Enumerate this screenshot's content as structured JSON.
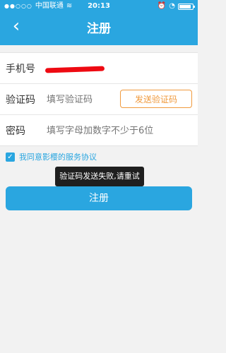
{
  "status_bar": {
    "carrier": "中国联通",
    "time": "20:13"
  },
  "header": {
    "title": "注册",
    "back_icon": "chevron-left-icon",
    "background_color": "#2aa6e0"
  },
  "form": {
    "phone": {
      "label": "手机号"
    },
    "code": {
      "label": "验证码",
      "placeholder": "填写验证码",
      "send_button": "发送验证码"
    },
    "password": {
      "label": "密码",
      "placeholder": "填写字母加数字不少于6位"
    }
  },
  "agreement": {
    "checked": true,
    "text": "我同意影樱的服务协议"
  },
  "toast": {
    "text": "验证码发送失败,请重试"
  },
  "register_button": {
    "label": "注册"
  },
  "colors": {
    "accent": "#2aa6e0",
    "send_button": "#f09a3d",
    "toast_bg": "#1f1f1f"
  }
}
